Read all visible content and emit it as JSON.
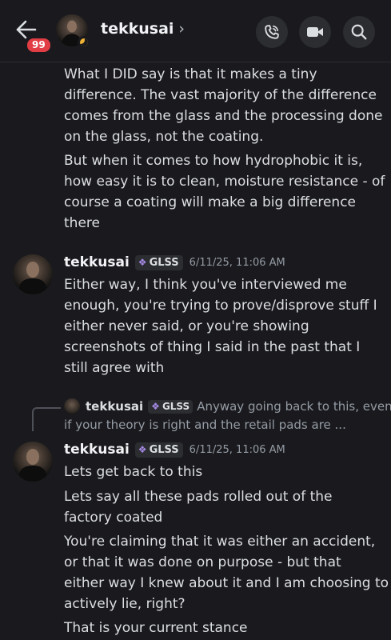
{
  "header": {
    "badge_count": "99",
    "username": "tekkusai",
    "chevron": "›",
    "icons": [
      "back-arrow-icon",
      "phone-icon",
      "video-camera-icon",
      "search-icon"
    ]
  },
  "messages": {
    "continued": {
      "lines": [
        "What I DID say is that it makes a tiny",
        "difference. The vast majority of the difference",
        "comes from the glass and the processing done",
        "on the glass, not the coating.",
        "But when it comes to how hydrophobic it is,",
        "how easy it is to clean, moisture resistance - of",
        "course a coating will make a big difference",
        "there"
      ]
    },
    "msg1": {
      "author": "tekkusai",
      "tag": "GLSS",
      "timestamp": "6/11/25, 11:06 AM",
      "lines": [
        "Either way, I think you've interviewed me",
        "enough, you're trying to prove/disprove stuff I",
        "either never said, or you're showing",
        "screenshots of thing I said in the past that I",
        "still agree with"
      ]
    },
    "reply": {
      "author": "tekkusai",
      "tag": "GLSS",
      "text_line1": "Anyway going back to this, even",
      "text_line2": "if your theory is right and the retail pads are ..."
    },
    "msg2": {
      "author": "tekkusai",
      "tag": "GLSS",
      "timestamp": "6/11/25, 11:06 AM",
      "lines": [
        "Lets get back to this",
        "Lets say all these pads rolled out of the",
        "factory coated",
        "You're claiming that it was either an accident,",
        "or that it was done on purpose - but that",
        "either way I knew about it and I am choosing to",
        "actively lie, right?",
        "That is your current stance"
      ]
    }
  },
  "colors": {
    "background": "#1a1a1e",
    "badge": "#e23d45",
    "status_idle": "#f0b232",
    "tag_gem": "#a98be8"
  }
}
